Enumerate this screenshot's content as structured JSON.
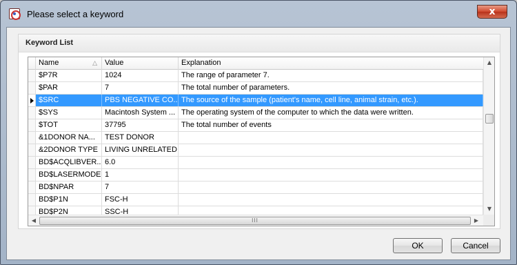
{
  "window": {
    "title": "Please select a keyword",
    "close_label": "x"
  },
  "group": {
    "title": "Keyword List"
  },
  "columns": {
    "name": "Name",
    "value": "Value",
    "explanation": "Explanation"
  },
  "rows": [
    {
      "name": "$P7R",
      "value": "1024",
      "explanation": "The range of parameter 7."
    },
    {
      "name": "$PAR",
      "value": "7",
      "explanation": "The total number of parameters."
    },
    {
      "name": "$SRC",
      "value": "PBS NEGATIVE CO...",
      "explanation": "The source of the sample (patient's name, cell line, animal strain, etc.).",
      "selected": true
    },
    {
      "name": "$SYS",
      "value": "Macintosh System ...",
      "explanation": "The operating system of the computer to which the data were written."
    },
    {
      "name": "$TOT",
      "value": "37795",
      "explanation": "The total number of events"
    },
    {
      "name": "&1DONOR NA...",
      "value": "TEST DONOR",
      "explanation": ""
    },
    {
      "name": "&2DONOR TYPE",
      "value": "LIVING UNRELATED",
      "explanation": ""
    },
    {
      "name": "BD$ACQLIBVER...",
      "value": "6.0",
      "explanation": ""
    },
    {
      "name": "BD$LASERMODE",
      "value": "1",
      "explanation": ""
    },
    {
      "name": "BD$NPAR",
      "value": "7",
      "explanation": ""
    },
    {
      "name": "BD$P1N",
      "value": "FSC-H",
      "explanation": ""
    },
    {
      "name": "BD$P2N",
      "value": "SSC-H",
      "explanation": ""
    }
  ],
  "buttons": {
    "ok": "OK",
    "cancel": "Cancel"
  },
  "scrollbar": {
    "grip": "III"
  },
  "colors": {
    "selection": "#3399ff"
  }
}
